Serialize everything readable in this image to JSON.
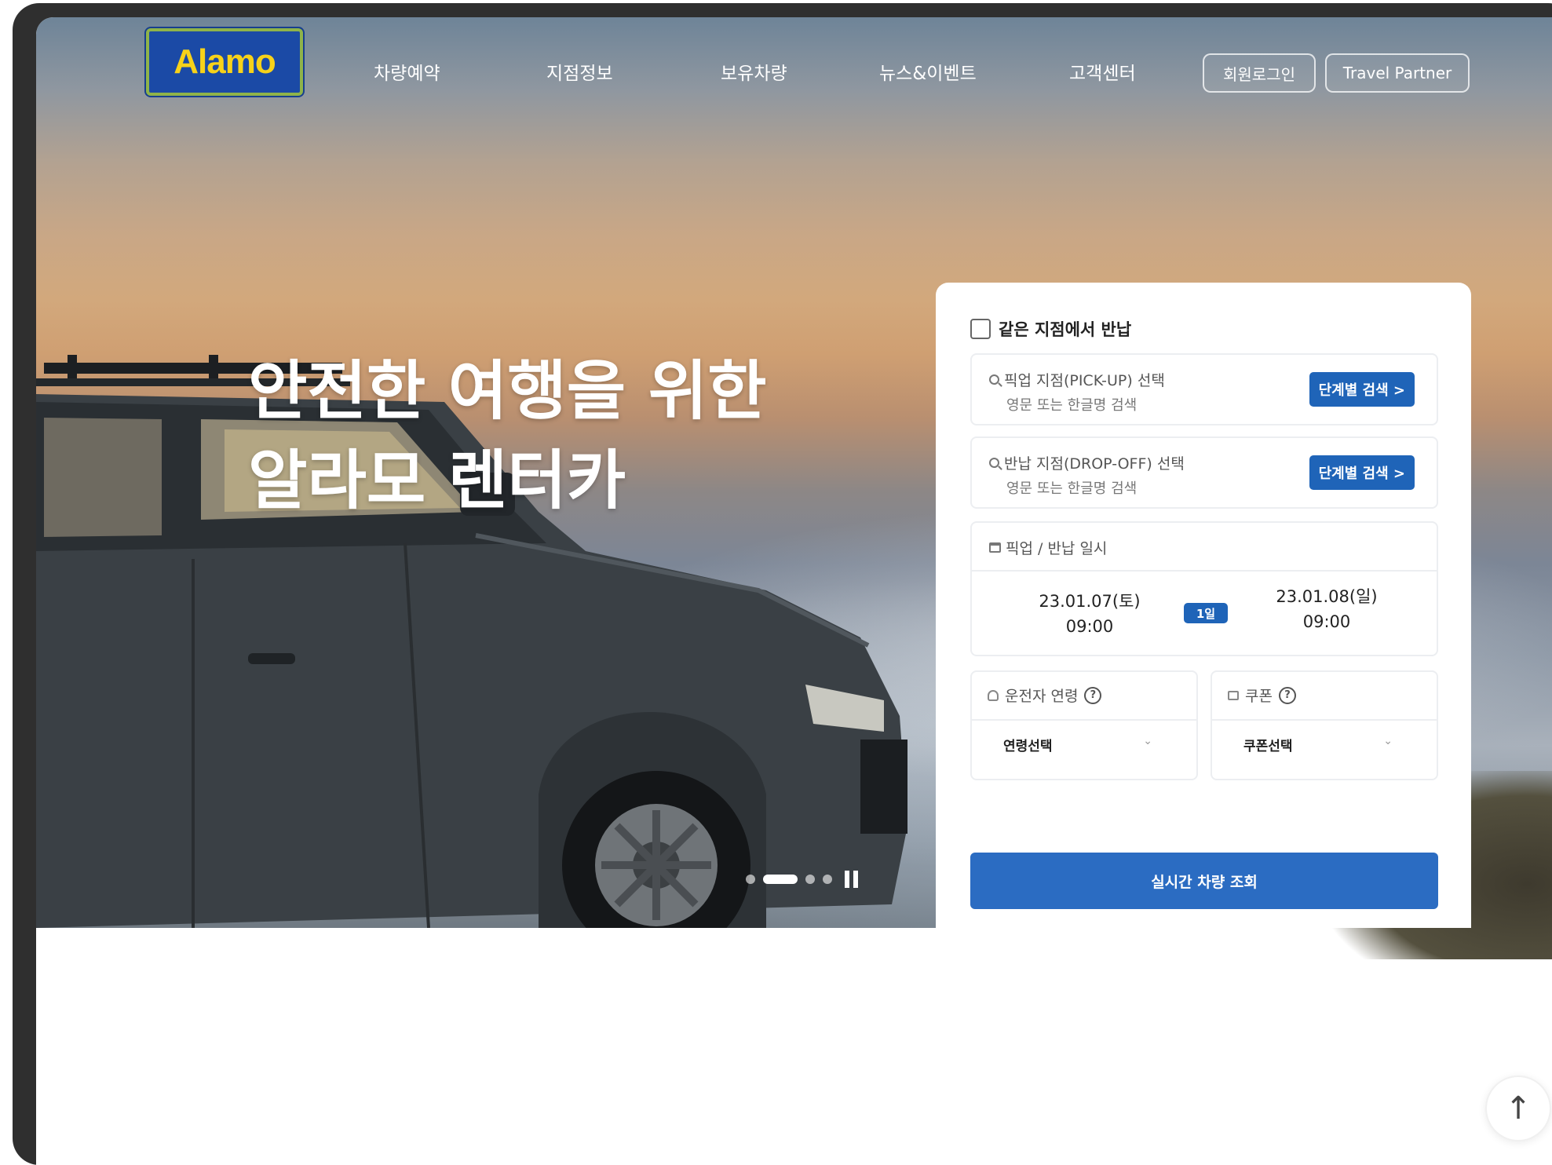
{
  "header": {
    "logo_text": "Alamo",
    "nav": [
      "차량예약",
      "지점정보",
      "보유차량",
      "뉴스&이벤트",
      "고객센터"
    ],
    "login_label": "회원로그인",
    "partner_label": "Travel Partner"
  },
  "hero": {
    "headline_line1": "안전한 여행을 위한",
    "headline_line2": "알라모 렌터카",
    "slides_total": 4,
    "slide_active": 2
  },
  "booking": {
    "same_location_label": "같은 지점에서 반납",
    "same_location_checked": false,
    "pickup": {
      "title": "픽업 지점(PICK-UP) 선택",
      "subtitle": "영문 또는 한글명 검색",
      "button": "단계별 검색 >"
    },
    "dropoff": {
      "title": "반납 지점(DROP-OFF) 선택",
      "subtitle": "영문 또는 한글명 검색",
      "button": "단계별 검색 >"
    },
    "datetime": {
      "title": "픽업 / 반납 일시",
      "pickup_date": "23.01.07(토)",
      "pickup_time": "09:00",
      "duration": "1일",
      "return_date": "23.01.08(일)",
      "return_time": "09:00"
    },
    "driver_age": {
      "title": "운전자 연령",
      "help": "?",
      "value": "연령선택"
    },
    "coupon": {
      "title": "쿠폰",
      "help": "?",
      "value": "쿠폰선택"
    },
    "submit_label": "실시간 차량 조회"
  },
  "colors": {
    "brand_blue": "#1f64b8",
    "search_blue": "#2b6cc2",
    "logo_yellow": "#f7d21a",
    "logo_green": "#8fb34a"
  },
  "icons": {
    "scroll_top": "↑"
  }
}
